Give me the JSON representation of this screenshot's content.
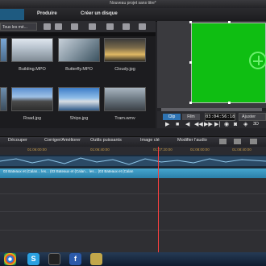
{
  "window": {
    "title": "Nouveau projet sans titre*"
  },
  "menu": {
    "produire": "Produire",
    "creer_disque": "Créer un disque"
  },
  "library": {
    "folder": "Tous les mé...",
    "items": [
      {
        "label": ""
      },
      {
        "label": "Building.MPO"
      },
      {
        "label": "Butterfly.MPO"
      },
      {
        "label": "Cloudy.jpg"
      },
      {
        "label": ""
      },
      {
        "label": "Road.jpg"
      },
      {
        "label": "Ships.jpg"
      },
      {
        "label": "Tram.wmv"
      }
    ]
  },
  "player": {
    "tab_clip": "Clip",
    "tab_film": "Film",
    "timecode": "03:04:56:18",
    "zoom_select": "Ajuster",
    "controls": [
      "▶",
      "■",
      "◀",
      "◀◀",
      "▶▶",
      "▶|",
      "◉",
      "◙",
      "◈",
      "3D"
    ]
  },
  "edit_tabs": [
    "Découper",
    "Corriger/Améliorer",
    "Outils puissants",
    "Image clé",
    "Modifier l'audio"
  ],
  "timeline": {
    "ruler": [
      "01:06:00:00",
      "01:06:40:00",
      "01:07:20:00",
      "01:08:00:00",
      "01:08:40:00"
    ],
    "clip_text": "03 Bateaux et (Calan... les... (03 Bateaux et (Calan... les... (03 Bateaux et (Calan"
  },
  "taskbar": {
    "apps": [
      "chrome-icon",
      "skype-icon",
      "media-icon",
      "word-icon",
      "files-icon"
    ]
  },
  "colors": {
    "canvas_green": "#0fbe12",
    "accent_blue": "#2e74b4",
    "timeline_clip": "#46a6cf"
  }
}
